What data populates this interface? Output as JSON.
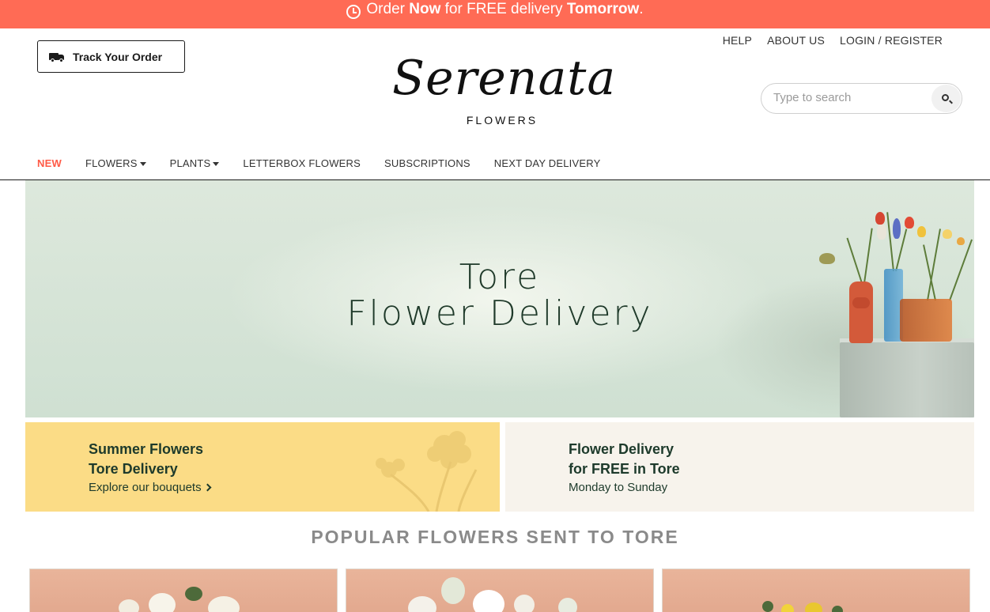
{
  "promo": {
    "part1": "Order ",
    "part2": "Now",
    "part3": " for FREE delivery ",
    "part4": "Tomorrow",
    "part5": ".",
    "icon": "clock-icon",
    "bg_color": "#ff6b55"
  },
  "track_order": {
    "label": "Track Your Order",
    "icon": "truck-icon"
  },
  "top_links": [
    {
      "label": "HELP"
    },
    {
      "label": "ABOUT US"
    },
    {
      "label": "LOGIN / REGISTER"
    }
  ],
  "logo": {
    "script": "Serenata",
    "sub": "FLOWERS"
  },
  "search": {
    "placeholder": "Type to search",
    "icon": "search-icon"
  },
  "nav": {
    "items": [
      {
        "label": "NEW",
        "highlight": true
      },
      {
        "label": "FLOWERS",
        "dropdown": true
      },
      {
        "label": "PLANTS",
        "dropdown": true
      },
      {
        "label": "LETTERBOX FLOWERS"
      },
      {
        "label": "SUBSCRIPTIONS"
      },
      {
        "label": "NEXT DAY DELIVERY"
      }
    ],
    "accent": "#ff5a46"
  },
  "hero": {
    "line1": "Tore",
    "line2": "Flower Delivery"
  },
  "tiles": [
    {
      "title1": "Summer Flowers",
      "title2": "Tore Delivery",
      "sub": "Explore our bouquets",
      "bg": "#fbdc86"
    },
    {
      "title1": "Flower Delivery",
      "title2": "for FREE in Tore",
      "sub": "Monday to Sunday",
      "bg": "#f7f3ec"
    }
  ],
  "section": {
    "title": "POPULAR FLOWERS SENT TO TORE"
  }
}
